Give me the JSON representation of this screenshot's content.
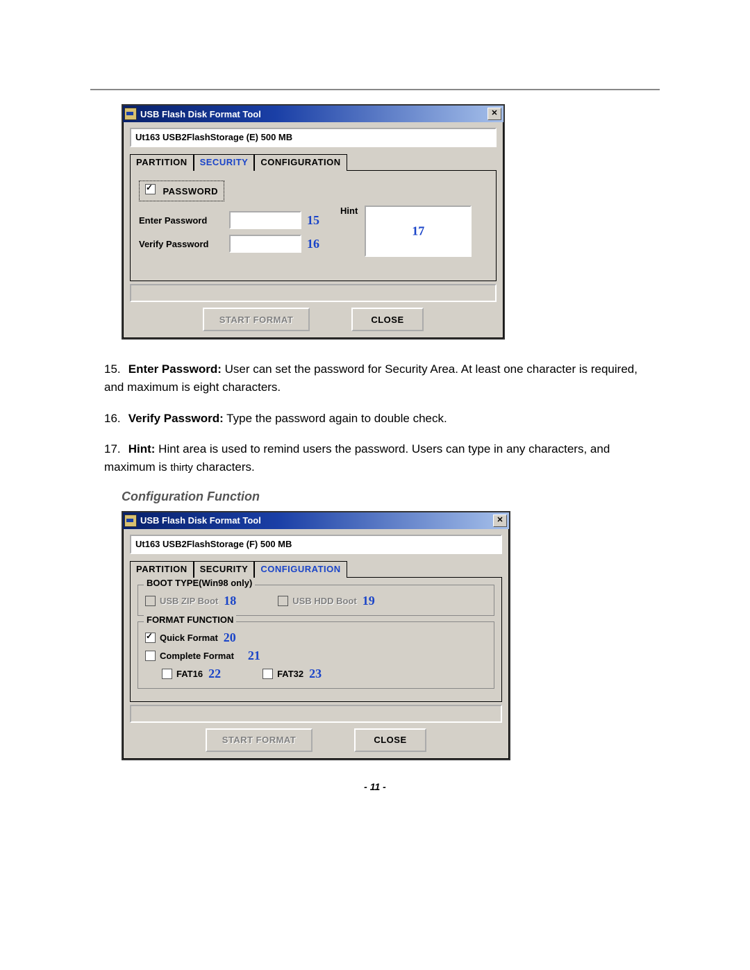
{
  "dlg1": {
    "title": "USB Flash Disk Format Tool",
    "device": "Ut163    USB2FlashStorage (E)  500 MB",
    "tabs": {
      "partition": "PARTITION",
      "security": "SECURITY",
      "config": "CONFIGURATION"
    },
    "password_legend": "PASSWORD",
    "enter_label": "Enter Password",
    "verify_label": "Verify Password",
    "hint_label": "Hint",
    "callouts": {
      "c15": "15",
      "c16": "16",
      "c17": "17"
    },
    "start_label": "START FORMAT",
    "close_label": "CLOSE"
  },
  "desc": {
    "n15": "15.",
    "n16": "16.",
    "n17": "17.",
    "b15": "Enter Password:",
    "t15": " User can set the password for Security Area. At least one character is required, and maximum is eight characters.",
    "b16": "Verify Password:",
    "t16": " Type the password again to double check.",
    "b17": "Hint:",
    "t17a": " Hint area is used to remind users the password. Users can type in any characters, and maximum is ",
    "t17b": "thirty",
    "t17c": " characters."
  },
  "section_title": "Configuration Function",
  "dlg2": {
    "title": "USB Flash Disk Format Tool",
    "device": "Ut163    USB2FlashStorage (F)  500 MB",
    "tabs": {
      "partition": "PARTITION",
      "security": "SECURITY",
      "config": "CONFIGURATION"
    },
    "boot_legend": "BOOT TYPE(Win98 only)",
    "zip_label": "USB ZIP Boot",
    "hdd_label": "USB HDD Boot",
    "format_legend": "FORMAT FUNCTION",
    "quick_label": "Quick Format",
    "complete_label": "Complete Format",
    "fat16_label": "FAT16",
    "fat32_label": "FAT32",
    "callouts": {
      "c18": "18",
      "c19": "19",
      "c20": "20",
      "c21": "21",
      "c22": "22",
      "c23": "23"
    },
    "start_label": "START FORMAT",
    "close_label": "CLOSE"
  },
  "page_number": "- 11 -"
}
